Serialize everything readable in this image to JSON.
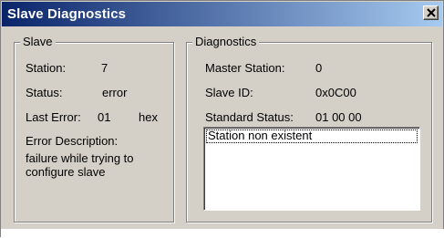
{
  "window": {
    "title": "Slave Diagnostics",
    "close_icon": "close-icon"
  },
  "slave": {
    "group_label": "Slave",
    "station_label": "Station:",
    "station_value": "7",
    "status_label": "Status:",
    "status_value": "error",
    "last_error_label": "Last Error:",
    "last_error_value": "01",
    "last_error_unit": "hex",
    "error_desc_label": "Error Description:",
    "error_desc_line1": "failure while trying to",
    "error_desc_line2": "configure slave"
  },
  "diagnostics": {
    "group_label": "Diagnostics",
    "master_station_label": "Master Station:",
    "master_station_value": "0",
    "slave_id_label": "Slave ID:",
    "slave_id_value": "0x0C00",
    "standard_status_label": "Standard Status:",
    "standard_status_value": "01 00 00",
    "messages": [
      "Station non existent"
    ]
  }
}
